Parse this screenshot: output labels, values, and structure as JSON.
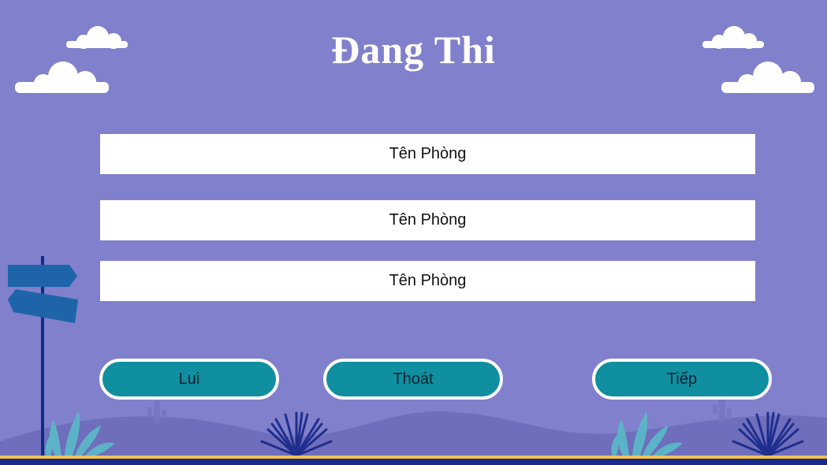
{
  "screen": {
    "title": "Đang Thi"
  },
  "rooms": [
    {
      "label": "Tên Phòng"
    },
    {
      "label": "Tên Phòng"
    },
    {
      "label": "Tên Phòng"
    }
  ],
  "buttons": {
    "back_label": "Lui",
    "exit_label": "Thoát",
    "next_label": "Tiếp"
  },
  "colors": {
    "background": "#8080CC",
    "button_fill": "#0F8F9F",
    "button_border": "#FFFFFF",
    "ground_line": "#F2C14E",
    "signpost": "#1E64A8"
  },
  "icons": [
    "cloud-icon",
    "signpost-icon",
    "plant-icon",
    "cactus-icon"
  ]
}
